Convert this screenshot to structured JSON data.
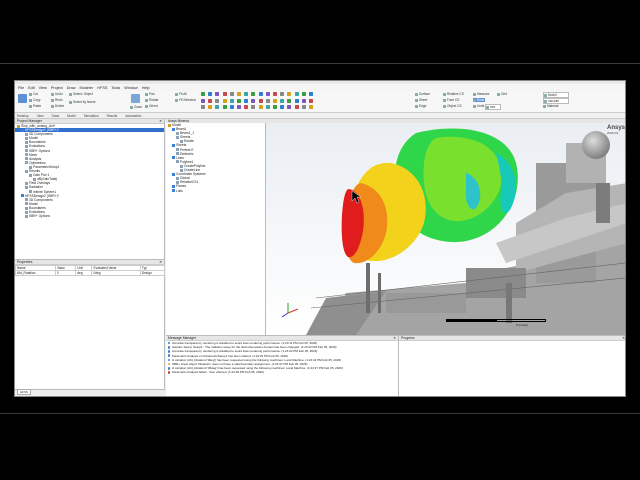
{
  "menu": [
    "File",
    "Edit",
    "View",
    "Project",
    "Draw",
    "Modeler",
    "HFSS",
    "Tools",
    "Window",
    "Help"
  ],
  "ribbon": {
    "clipboard": [
      "Cut",
      "Copy",
      "Paste",
      "Undo",
      "Redo",
      "Delete"
    ],
    "select": [
      "Select: Object",
      "Select by Name"
    ],
    "zoom_label": "Zoom",
    "pan_label": "Pan",
    "rotate_label": "Rotate",
    "orient_label": "Orient",
    "fit": [
      "Fit All",
      "Fit Selected"
    ],
    "modeler": [
      "Surface",
      "Sheet",
      "Edge",
      "Measure",
      "Ruler",
      "Grid",
      "Units"
    ],
    "units_value": "mm",
    "cs": [
      "Relative CS",
      "Face CS",
      "Object CS"
    ],
    "model_dropdown": "Model",
    "material_dropdown": "vacuum",
    "material_label": "Material",
    "ansys_label": "Ansys Minerva"
  },
  "ribbon_tabs": [
    "Desktop",
    "View",
    "Draw",
    "Model",
    "Simulation",
    "Results",
    "Automation"
  ],
  "project_manager": {
    "title": "Project Manager",
    "items": [
      {
        "label": "Ship_with_analog_Ant*",
        "indent": 0
      },
      {
        "label": "HFSSDesign1 (SBR+)*",
        "indent": 1,
        "selected": true
      },
      {
        "label": "3D Components",
        "indent": 2
      },
      {
        "label": "Model",
        "indent": 2
      },
      {
        "label": "Boundaries",
        "indent": 2
      },
      {
        "label": "Excitations",
        "indent": 2
      },
      {
        "label": "SBR+ Options",
        "indent": 2
      },
      {
        "label": "Mesh",
        "indent": 2
      },
      {
        "label": "Analysis",
        "indent": 2
      },
      {
        "label": "Optimetrics",
        "indent": 2
      },
      {
        "label": "ParametricSetup1",
        "indent": 3
      },
      {
        "label": "Results",
        "indent": 2
      },
      {
        "label": "Gain Plot 1",
        "indent": 3
      },
      {
        "label": "dB(GainTotal)",
        "indent": 4
      },
      {
        "label": "Field Overlays",
        "indent": 2
      },
      {
        "label": "Radiation",
        "indent": 2
      },
      {
        "label": "Infinite Sphere1",
        "indent": 3
      },
      {
        "label": "HFSSDesign2 (SBR+)*",
        "indent": 1
      },
      {
        "label": "3D Components",
        "indent": 2
      },
      {
        "label": "Model",
        "indent": 2
      },
      {
        "label": "Boundaries",
        "indent": 2
      },
      {
        "label": "Excitations",
        "indent": 2
      },
      {
        "label": "SBR+ Options",
        "indent": 2
      }
    ]
  },
  "properties": {
    "title": "Properties",
    "headers": [
      "Name",
      "Value",
      "Unit",
      "Evaluated Value",
      "Typ"
    ],
    "rows": [
      [
        "Afd_Rotation",
        "0",
        "deg",
        "0deg",
        "Design"
      ]
    ],
    "footer_tab": "HFSS"
  },
  "history_tree": {
    "items": [
      {
        "label": "Model",
        "indent": 0
      },
      {
        "label": "Beam1",
        "indent": 1
      },
      {
        "label": "Beam1_1",
        "indent": 2
      },
      {
        "label": "Sheets",
        "indent": 2
      },
      {
        "label": "Rotate",
        "indent": 3
      },
      {
        "label": "Sheets",
        "indent": 1
      },
      {
        "label": "Perfect E",
        "indent": 2
      },
      {
        "label": "Dielectric",
        "indent": 2
      },
      {
        "label": "Lines",
        "indent": 1
      },
      {
        "label": "Polyline1",
        "indent": 2
      },
      {
        "label": "CreatePolyline",
        "indent": 3
      },
      {
        "label": "CreateLine",
        "indent": 3
      },
      {
        "label": "Coordinate Systems",
        "indent": 1
      },
      {
        "label": "Global",
        "indent": 2
      },
      {
        "label": "RelativeCS1",
        "indent": 2
      },
      {
        "label": "Planes",
        "indent": 1
      },
      {
        "label": "Lists",
        "indent": 1
      }
    ]
  },
  "view": {
    "logo": "Ansys",
    "logo_sub": "2026 R1",
    "scale_label": "5 (meter)"
  },
  "messages": {
    "title": "Message Manager",
    "lines": [
      {
        "type": "info",
        "text": "Accurate transparency rendering is disabled to avoid slow rendering performance. (1:20:11 PM  Feb 05, 2026)"
      },
      {
        "type": "info",
        "text": "Solution Setup: Setup1 : The radiation setup for the field observation domain has been changed. (1:24:22 PM  Feb 05, 2026)"
      },
      {
        "type": "info",
        "text": "Accurate transparency rendering is disabled to avoid slow rendering performance. (1:24:22 PM  Feb 05, 2026)"
      },
      {
        "type": "info",
        "text": "Parametric Analysis on ParametricSetup1 has been started. (1:24:23 PM  Feb 05, 2026)"
      },
      {
        "type": "info",
        "text": "H variation (Afd_Rotation='0deg') has been requested using the following machines: Local Machine. (1:24:34 PM  Feb 05, 2026)"
      },
      {
        "type": "warn",
        "text": "SBR+ sheet object 'Dielectric' does not have a valid boundary assignment. (1:24:37 PM  Feb 05, 2026)"
      },
      {
        "type": "info",
        "text": "H variation (Afd_Rotation='45deg') has been requested using the following machines: Local Machine. (1:24:37 PM  Feb 05, 2026)"
      },
      {
        "type": "error",
        "text": "Parametric Analysis failed - User aborted. (1:24:39 PM  Feb 05, 2026)"
      }
    ]
  },
  "progress": {
    "title": "Progress"
  },
  "colors": {
    "selection": "#2f6fce",
    "info": "#3a7bd5",
    "warn": "#e3a21a",
    "error": "#d23b3b"
  }
}
